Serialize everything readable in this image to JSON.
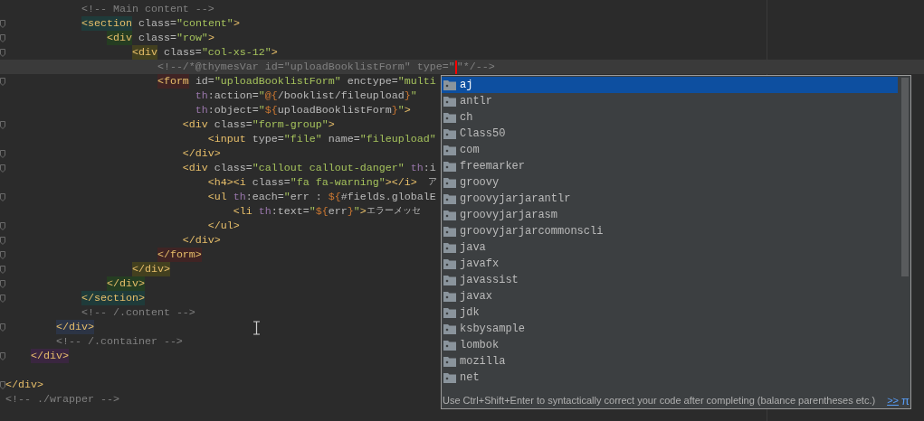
{
  "editor": {
    "lines": [
      {
        "fold": false,
        "current": false,
        "tokens": [
          {
            "kind": "comment",
            "text": "            <!-- Main content -->"
          }
        ]
      },
      {
        "fold": true,
        "current": false,
        "tokens": [
          {
            "kind": "tag",
            "text": "            <section",
            "color": "#1f3b3a"
          },
          {
            "kind": "attr",
            "text": " class="
          },
          {
            "kind": "value",
            "text": "\"content\""
          },
          {
            "kind": "tag",
            "text": ">"
          }
        ]
      },
      {
        "fold": true,
        "current": false,
        "tokens": [
          {
            "kind": "tag",
            "text": "                <div",
            "color": "#253d22"
          },
          {
            "kind": "attr",
            "text": " class="
          },
          {
            "kind": "value",
            "text": "\"row\""
          },
          {
            "kind": "tag",
            "text": ">"
          }
        ]
      },
      {
        "fold": true,
        "current": false,
        "tokens": [
          {
            "kind": "tag",
            "text": "                    <div",
            "color": "#43401f"
          },
          {
            "kind": "attr",
            "text": " class="
          },
          {
            "kind": "value",
            "text": "\"col-xs-12\""
          },
          {
            "kind": "tag",
            "text": ">"
          }
        ]
      },
      {
        "fold": false,
        "current": true,
        "tokens": [
          {
            "kind": "comment",
            "text": "                        <!--/*@thymesVar id=\"uploadBooklistForm\" type=\""
          },
          {
            "kind": "caret"
          },
          {
            "kind": "comment",
            "text": "\"*/-->"
          }
        ]
      },
      {
        "fold": true,
        "current": false,
        "tokens": [
          {
            "kind": "tag",
            "text": "                        <form",
            "color": "#402424"
          },
          {
            "kind": "attr",
            "text": " id="
          },
          {
            "kind": "value",
            "text": "\"uploadBooklistForm\""
          },
          {
            "kind": "attr",
            "text": " enctype="
          },
          {
            "kind": "value",
            "text": "\"multi"
          }
        ]
      },
      {
        "fold": false,
        "current": false,
        "tokens": [
          {
            "kind": "prefix",
            "text": "                              th"
          },
          {
            "kind": "attr",
            "text": ":action="
          },
          {
            "kind": "value",
            "text": "\""
          },
          {
            "kind": "expr",
            "text": "@{"
          },
          {
            "kind": "plain",
            "text": "/booklist/fileupload"
          },
          {
            "kind": "expr",
            "text": "}"
          },
          {
            "kind": "value",
            "text": "\""
          }
        ]
      },
      {
        "fold": false,
        "current": false,
        "tokens": [
          {
            "kind": "prefix",
            "text": "                              th"
          },
          {
            "kind": "attr",
            "text": ":object="
          },
          {
            "kind": "value",
            "text": "\""
          },
          {
            "kind": "expr",
            "text": "${"
          },
          {
            "kind": "plain",
            "text": "uploadBooklistForm"
          },
          {
            "kind": "expr",
            "text": "}"
          },
          {
            "kind": "value",
            "text": "\""
          },
          {
            "kind": "tag",
            "text": ">"
          }
        ]
      },
      {
        "fold": true,
        "current": false,
        "tokens": [
          {
            "kind": "tag",
            "text": "                            <div"
          },
          {
            "kind": "attr",
            "text": " class="
          },
          {
            "kind": "value",
            "text": "\"form-group\""
          },
          {
            "kind": "tag",
            "text": ">"
          }
        ]
      },
      {
        "fold": false,
        "current": false,
        "tokens": [
          {
            "kind": "tag",
            "text": "                                <input"
          },
          {
            "kind": "attr",
            "text": " type="
          },
          {
            "kind": "value",
            "text": "\"file\""
          },
          {
            "kind": "attr",
            "text": " name="
          },
          {
            "kind": "value",
            "text": "\"fileupload\""
          }
        ]
      },
      {
        "fold": true,
        "current": false,
        "tokens": [
          {
            "kind": "tag",
            "text": "                            </div>"
          }
        ]
      },
      {
        "fold": true,
        "current": false,
        "tokens": [
          {
            "kind": "tag",
            "text": "                            <div"
          },
          {
            "kind": "attr",
            "text": " class="
          },
          {
            "kind": "value",
            "text": "\"callout callout-danger\""
          },
          {
            "kind": "prefix",
            "text": " th"
          },
          {
            "kind": "attr",
            "text": ":i"
          }
        ]
      },
      {
        "fold": false,
        "current": false,
        "tokens": [
          {
            "kind": "tag",
            "text": "                                <h4><i"
          },
          {
            "kind": "attr",
            "text": " class="
          },
          {
            "kind": "value",
            "text": "\"fa fa-warning\""
          },
          {
            "kind": "tag",
            "text": "></i>"
          },
          {
            "kind": "cjk",
            "text": "  ア"
          }
        ]
      },
      {
        "fold": true,
        "current": false,
        "tokens": [
          {
            "kind": "tag",
            "text": "                                <ul"
          },
          {
            "kind": "prefix",
            "text": " th"
          },
          {
            "kind": "attr",
            "text": ":each="
          },
          {
            "kind": "value",
            "text": "\""
          },
          {
            "kind": "plain",
            "text": "err : "
          },
          {
            "kind": "expr",
            "text": "${"
          },
          {
            "kind": "plain",
            "text": "#fields.globalE"
          }
        ]
      },
      {
        "fold": false,
        "current": false,
        "tokens": [
          {
            "kind": "tag",
            "text": "                                    <li"
          },
          {
            "kind": "prefix",
            "text": " th"
          },
          {
            "kind": "attr",
            "text": ":text="
          },
          {
            "kind": "value",
            "text": "\""
          },
          {
            "kind": "expr",
            "text": "${"
          },
          {
            "kind": "plain",
            "text": "err"
          },
          {
            "kind": "expr",
            "text": "}"
          },
          {
            "kind": "value",
            "text": "\""
          },
          {
            "kind": "tag",
            "text": ">"
          },
          {
            "kind": "cjk",
            "text": "エラーメッセ"
          }
        ]
      },
      {
        "fold": true,
        "current": false,
        "tokens": [
          {
            "kind": "tag",
            "text": "                                </ul>"
          }
        ]
      },
      {
        "fold": true,
        "current": false,
        "tokens": [
          {
            "kind": "tag",
            "text": "                            </div>"
          }
        ]
      },
      {
        "fold": true,
        "current": false,
        "tokens": [
          {
            "kind": "tag",
            "text": "                        </form>",
            "color": "#402424"
          }
        ]
      },
      {
        "fold": true,
        "current": false,
        "tokens": [
          {
            "kind": "tag",
            "text": "                    </div>",
            "color": "#43401f"
          }
        ]
      },
      {
        "fold": true,
        "current": false,
        "tokens": [
          {
            "kind": "tag",
            "text": "                </div>",
            "color": "#253d22"
          }
        ]
      },
      {
        "fold": true,
        "current": false,
        "tokens": [
          {
            "kind": "tag",
            "text": "            </section>",
            "color": "#1f3b3a"
          }
        ]
      },
      {
        "fold": false,
        "current": false,
        "tokens": [
          {
            "kind": "comment",
            "text": "            <!-- /.content -->"
          }
        ]
      },
      {
        "fold": true,
        "current": false,
        "tokens": [
          {
            "kind": "tag",
            "text": "        </div>",
            "color": "#2c3445"
          }
        ]
      },
      {
        "fold": false,
        "current": false,
        "tokens": [
          {
            "kind": "comment",
            "text": "        <!-- /.container -->"
          }
        ]
      },
      {
        "fold": true,
        "current": false,
        "tokens": [
          {
            "kind": "tag",
            "text": "    </div>",
            "color": "#3a2640"
          }
        ]
      },
      {
        "fold": false,
        "current": false
      },
      {
        "fold": true,
        "current": false,
        "tokens": [
          {
            "kind": "tag",
            "text": "</div>"
          }
        ]
      },
      {
        "fold": false,
        "current": false,
        "tokens": [
          {
            "kind": "comment",
            "text": "<!-- ./wrapper -->"
          }
        ]
      }
    ]
  },
  "completion": {
    "items": [
      {
        "label": "aj",
        "selected": true
      },
      {
        "label": "antlr",
        "selected": false
      },
      {
        "label": "ch",
        "selected": false
      },
      {
        "label": "Class50",
        "selected": false
      },
      {
        "label": "com",
        "selected": false
      },
      {
        "label": "freemarker",
        "selected": false
      },
      {
        "label": "groovy",
        "selected": false
      },
      {
        "label": "groovyjarjarantlr",
        "selected": false
      },
      {
        "label": "groovyjarjarasm",
        "selected": false
      },
      {
        "label": "groovyjarjarcommonscli",
        "selected": false
      },
      {
        "label": "java",
        "selected": false
      },
      {
        "label": "javafx",
        "selected": false
      },
      {
        "label": "javassist",
        "selected": false
      },
      {
        "label": "javax",
        "selected": false
      },
      {
        "label": "jdk",
        "selected": false
      },
      {
        "label": "ksbysample",
        "selected": false
      },
      {
        "label": "lombok",
        "selected": false
      },
      {
        "label": "mozilla",
        "selected": false
      },
      {
        "label": "net",
        "selected": false
      }
    ],
    "hint": "Use Ctrl+Shift+Enter to syntactically correct your code after completing (balance parentheses etc.)",
    "hint_link": ">>",
    "pi": "π"
  }
}
